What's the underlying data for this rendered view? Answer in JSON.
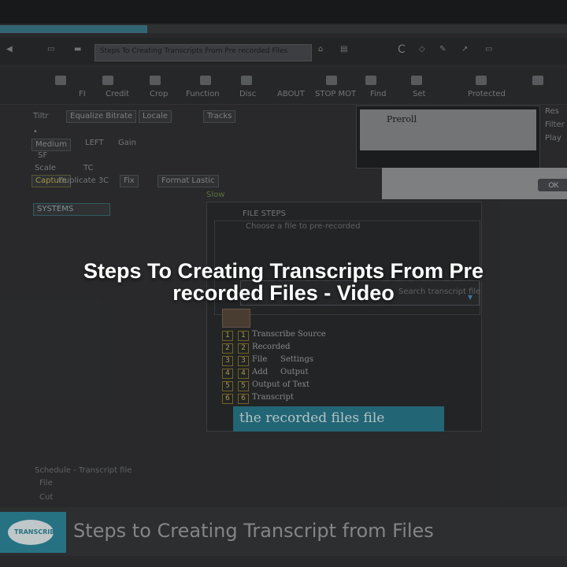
{
  "window": {
    "progress_percent": 26,
    "address_text": "Steps To Creating Transcripts From Pre recorded Files"
  },
  "ribbon": {
    "labels": [
      "FI",
      "Credit",
      "Crop",
      "Function",
      "Disc",
      "ABOUT",
      "STOP MOT",
      "Find",
      "Set",
      "Protected"
    ]
  },
  "left_panel": {
    "row1": [
      "Tiltr",
      "Equalize Bitrate",
      "Locale",
      "Tracks"
    ],
    "row2": [
      "Medium",
      "LEFT",
      "Gain"
    ],
    "row3": [
      "SF"
    ],
    "row4": [
      "Scale",
      "TC"
    ],
    "row5": [
      "Capture",
      "Duplicate 3C",
      "Fix",
      "Format Lastic"
    ],
    "row6": [
      "Slow"
    ],
    "row7": [
      "SYSTEMS"
    ]
  },
  "preview": {
    "title": "Preroll",
    "side_labels": [
      "Res",
      "Filter",
      "Play"
    ],
    "ok_label": "OK"
  },
  "dialog": {
    "heading": "FILE STEPS",
    "subheading": "Choose a file to pre-recorded",
    "search_text": "Search transcript file",
    "list": [
      {
        "num": "1",
        "text": "Transcribe Source"
      },
      {
        "num": "2",
        "text": "Recorded"
      },
      {
        "num": "3",
        "text": "File",
        "extra": "Settings"
      },
      {
        "num": "4",
        "text": "Add",
        "extra": "Output"
      },
      {
        "num": "5",
        "text": "Output of Text"
      },
      {
        "num": "6",
        "text": "Transcript"
      }
    ],
    "highlight_text": "the recorded files file"
  },
  "lower_left": {
    "line1": "Schedule - Transcript file",
    "line2": "File",
    "line3": "Cut"
  },
  "headline": {
    "line1": "Steps To Creating Transcripts From Pre",
    "line2": "recorded Files - Video"
  },
  "footer": {
    "logo_text": "TRANSCRIBER",
    "title": "Steps to Creating Transcript from Files"
  },
  "colors": {
    "accent": "#2f8ca0",
    "highlight": "#2a7c8e",
    "text_white": "#ffffff"
  }
}
